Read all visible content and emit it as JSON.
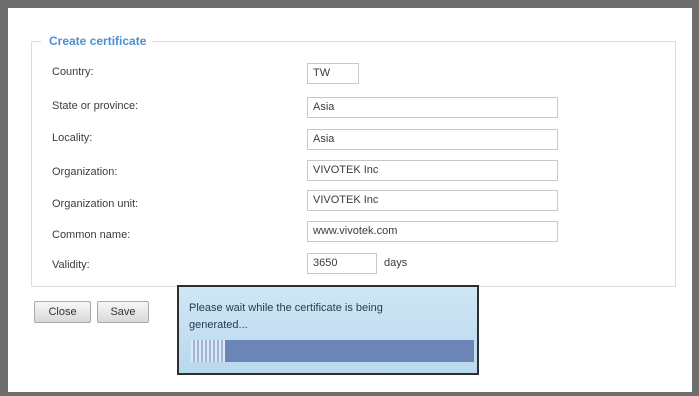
{
  "section_title": "Create certificate",
  "form": {
    "country": {
      "label": "Country:",
      "value": "TW"
    },
    "state": {
      "label": "State or province:",
      "value": "Asia"
    },
    "locality": {
      "label": "Locality:",
      "value": "Asia"
    },
    "organization": {
      "label": "Organization:",
      "value": "VIVOTEK Inc"
    },
    "organization_unit": {
      "label": "Organization unit:",
      "value": "VIVOTEK Inc"
    },
    "common_name": {
      "label": "Common name:",
      "value": "www.vivotek.com"
    },
    "validity": {
      "label": "Validity:",
      "value": "3650",
      "unit": "days"
    }
  },
  "buttons": {
    "close": "Close",
    "save": "Save"
  },
  "dialog": {
    "message": "Please wait while the certificate is being generated...",
    "progress_fraction": 0.12
  },
  "colors": {
    "legend": "#4a8fd1",
    "dialog_bg": "#c4dff1",
    "progress_track": "#6c85b7"
  }
}
